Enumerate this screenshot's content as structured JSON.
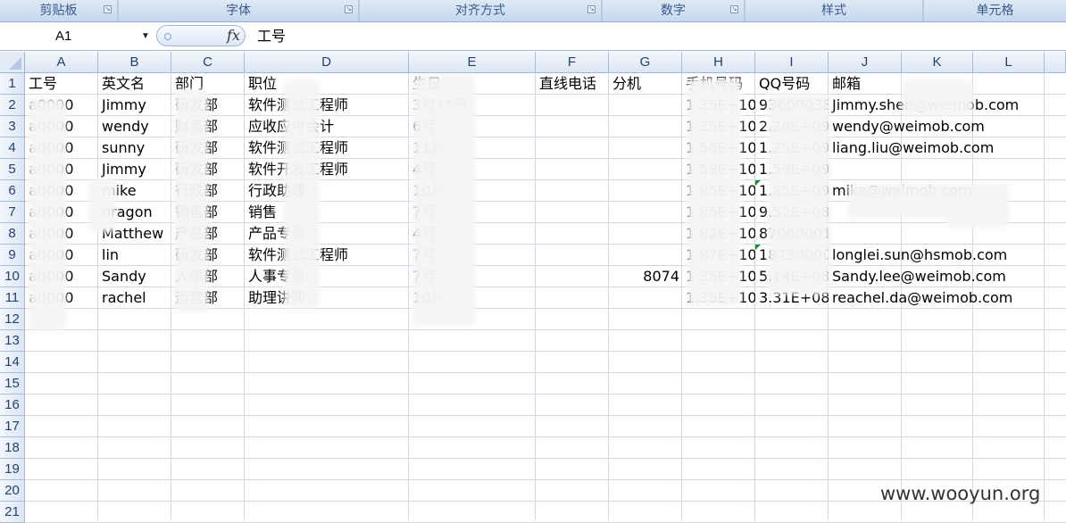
{
  "ribbon": {
    "groups": [
      {
        "label": "剪贴板",
        "launcher": true
      },
      {
        "label": "字体",
        "launcher": true
      },
      {
        "label": "对齐方式",
        "launcher": true
      },
      {
        "label": "数字",
        "launcher": true
      },
      {
        "label": "样式",
        "launcher": false
      },
      {
        "label": "单元格",
        "launcher": false
      }
    ]
  },
  "formula_bar": {
    "name_box": "A1",
    "fx_label": "fx",
    "content": "工号"
  },
  "sheet": {
    "columns": [
      "A",
      "B",
      "C",
      "D",
      "E",
      "F",
      "G",
      "H",
      "I",
      "J",
      "K",
      "L"
    ],
    "row_numbers": [
      "1",
      "2",
      "3",
      "4",
      "5",
      "6",
      "7",
      "8",
      "9",
      "10",
      "11",
      "12",
      "13",
      "14",
      "15",
      "16",
      "17",
      "18",
      "19",
      "20",
      "21"
    ],
    "rows": [
      [
        "工号",
        "英文名",
        "部门",
        "职位",
        "生日",
        "直线电话",
        "分机",
        "手机号码",
        "QQ号码",
        "邮箱"
      ],
      [
        "a0000",
        "Jimmy",
        "研发部",
        "软件测试工程师",
        "3月15日",
        "",
        "",
        "1.35E+10",
        "936000381",
        "Jimmy.shen@weimob.com"
      ],
      [
        "a0000",
        "wendy",
        "财务部",
        "应收应付会计",
        "6月1日",
        "",
        "",
        "1.35E+10",
        "2.28E+09",
        "wendy@weimob.com"
      ],
      [
        "a0000",
        "sunny",
        "研发部",
        "软件测试工程师",
        "11月8日",
        "",
        "",
        "1.56E+10",
        "1.25E+09",
        "liang.liu@weimob.com"
      ],
      [
        "a0000",
        "Jimmy",
        "研发部",
        "软件开发工程师",
        "4月25日",
        "",
        "",
        "1.59E+10",
        "1.59E+09",
        ""
      ],
      [
        "a0000",
        "mike",
        "行政部",
        "行政助理",
        "10月1日",
        "",
        "",
        "1.85E+10",
        "1.85E+09",
        "mike@weimob.com"
      ],
      [
        "a0000",
        "dragon",
        "销售部",
        "销售",
        "7月1日",
        "",
        "",
        "1.85E+10",
        "9.52E+08",
        ""
      ],
      [
        "a0000",
        "Matthew",
        "产品部",
        "产品专员",
        "4月1日",
        "",
        "",
        "1.82E+10",
        "870600015",
        ""
      ],
      [
        "a0000",
        "lin",
        "研发部",
        "软件测试工程师",
        "7月1日",
        "",
        "",
        "1.87E+10",
        "1873000048",
        "longlei.sun@hsmob.com"
      ],
      [
        "a0000",
        "Sandy",
        "人事部",
        "人事专员",
        "7月1日",
        "",
        "8074",
        "1.35E+10",
        "5.14E+08",
        "Sandy.lee@weimob.com"
      ],
      [
        "a0000",
        "rachel",
        "运营部",
        "助理讲师",
        "10月1日",
        "",
        "",
        "1.35E+10",
        "3.31E+08",
        "reachel.da@weimob.com"
      ]
    ]
  },
  "watermark": "www.wooyun.org"
}
